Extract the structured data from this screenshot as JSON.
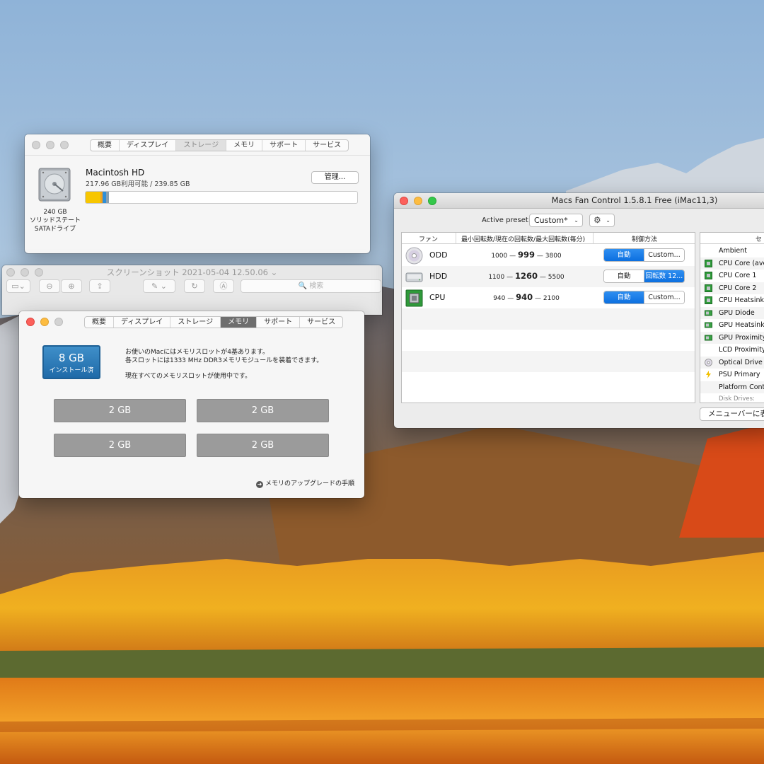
{
  "colors": {
    "storage_segments": [
      "#f7c600",
      "#f0a020",
      "#2e8fd8",
      "#8aa0b0"
    ],
    "accent": "#1177e6",
    "memory_badge": "#2b7cbc",
    "slot": "#9b9b9b"
  },
  "storage_window": {
    "tabs": [
      "概要",
      "ディスプレイ",
      "ストレージ",
      "メモリ",
      "サポート",
      "サービス"
    ],
    "active_tab": "ストレージ",
    "disk": {
      "icon": "hard-drive-icon",
      "capacity": "240 GB",
      "type_line1": "ソリッドステート",
      "type_line2": "SATAドライブ",
      "name": "Macintosh HD",
      "availability": "217.96 GB利用可能 / 239.85 GB",
      "used_fraction": 0.091
    },
    "manage_label": "管理..."
  },
  "preview_window": {
    "title": "スクリーンショット 2021-05-04 12.50.06 ⌄",
    "search_placeholder": "検索"
  },
  "memory_window": {
    "tabs": [
      "概要",
      "ディスプレイ",
      "ストレージ",
      "メモリ",
      "サポート",
      "サービス"
    ],
    "active_tab": "メモリ",
    "total": "8 GB",
    "total_caption": "インストール済",
    "info_line1": "お使いのMacにはメモリスロットが4基あります。",
    "info_line2": "各スロットには1333 MHz DDR3メモリモジュールを装着できます。",
    "info_line3": "現在すべてのメモリスロットが使用中です。",
    "slots": [
      "2 GB",
      "2 GB",
      "2 GB",
      "2 GB"
    ],
    "upgrade_link": "メモリのアップグレードの手順"
  },
  "fan_window": {
    "title": "Macs Fan Control 1.5.8.1 Free (iMac11,3)",
    "preset_label": "Active preset:",
    "preset_value": "Custom*",
    "gear_icon": "gear-icon",
    "columns": {
      "fan": "ファン",
      "speeds": "最小回転数/現在の回転数/最大回転数(毎分)",
      "control": "制御方法",
      "sensors": "セ"
    },
    "fans": [
      {
        "name": "ODD",
        "icon": "optical-disc-icon",
        "min": "1000",
        "current": "999",
        "max": "3800",
        "auto": "自動",
        "custom": "Custom...",
        "mode": "auto"
      },
      {
        "name": "HDD",
        "icon": "hard-drive-icon",
        "min": "1100",
        "current": "1260",
        "max": "5500",
        "auto": "自動",
        "custom": "回転数 12...",
        "mode": "custom"
      },
      {
        "name": "CPU",
        "icon": "cpu-chip-icon",
        "min": "940",
        "current": "940",
        "max": "2100",
        "auto": "自動",
        "custom": "Custom...",
        "mode": "auto"
      }
    ],
    "dash": "—",
    "sensors": [
      {
        "label": "Ambient",
        "icon": ""
      },
      {
        "label": "CPU Core (ave",
        "icon": "chip"
      },
      {
        "label": "CPU Core 1",
        "icon": "chip"
      },
      {
        "label": "CPU Core 2",
        "icon": "chip"
      },
      {
        "label": "CPU Heatsink",
        "icon": "chip"
      },
      {
        "label": "GPU Diode",
        "icon": "gpu"
      },
      {
        "label": "GPU Heatsink",
        "icon": "gpu"
      },
      {
        "label": "GPU Proximity",
        "icon": "gpu"
      },
      {
        "label": "LCD Proximity",
        "icon": ""
      },
      {
        "label": "Optical Drive",
        "icon": "disc"
      },
      {
        "label": "PSU Primary",
        "icon": "bolt"
      },
      {
        "label": "Platform Contr",
        "icon": ""
      },
      {
        "label": "Disk Drives:",
        "icon": "",
        "muted": true
      }
    ],
    "menubar_button": "メニューバーに表"
  }
}
